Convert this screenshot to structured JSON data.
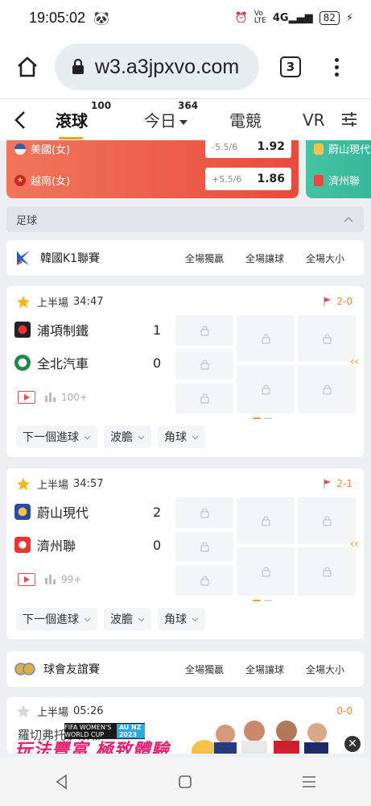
{
  "status": {
    "time": "19:05:02",
    "battery": "82",
    "net": "4G"
  },
  "browser": {
    "url": "w3.a3jpxvo.com",
    "tab_count": "3"
  },
  "nav": {
    "tabs": [
      {
        "label": "滾球",
        "count": "100"
      },
      {
        "label": "今日",
        "count": "364"
      },
      {
        "label": "電競"
      },
      {
        "label": "VR"
      }
    ]
  },
  "banner": {
    "home": "美國(女)",
    "home_hcp": "-5.5/6",
    "home_odd": "1.92",
    "away": "越南(女)",
    "away_hcp": "+5.5/6",
    "away_odd": "1.86",
    "next_home": "蔚山現代",
    "next_away": "濟州聯"
  },
  "section": {
    "title": "足球"
  },
  "markets": {
    "m1": "全場獨贏",
    "m2": "全場讓球",
    "m3": "全場大小"
  },
  "leagues": [
    {
      "name": "韓國K1聯賽"
    },
    {
      "name": "球會友誼賽"
    }
  ],
  "matches": [
    {
      "period": "上半場",
      "clock": "34:47",
      "corners": "2-0",
      "home": "浦項制鐵",
      "home_score": "1",
      "away": "全北汽車",
      "away_score": "0",
      "markets_count": "100+",
      "chip1": "下一個進球",
      "chip2": "波膽",
      "chip3": "角球"
    },
    {
      "period": "上半場",
      "clock": "34:57",
      "corners": "2-1",
      "home": "蔚山現代",
      "home_score": "2",
      "away": "濟州聯",
      "away_score": "0",
      "markets_count": "99+",
      "chip1": "下一個進球",
      "chip2": "波膽",
      "chip3": "角球"
    }
  ],
  "ad": {
    "period": "上半場",
    "clock": "05:26",
    "corners": "0-0",
    "team": "羅切弗托伊斯聯",
    "slogan": "玩法豐富 極致體驗",
    "event": "FIFA WOMEN'S WORLD CUP",
    "event_tag": "AU NZ 2023"
  },
  "colors": {
    "accent": "#f0a020",
    "banner_red": "#e94b3c",
    "banner_green": "#36b598"
  }
}
